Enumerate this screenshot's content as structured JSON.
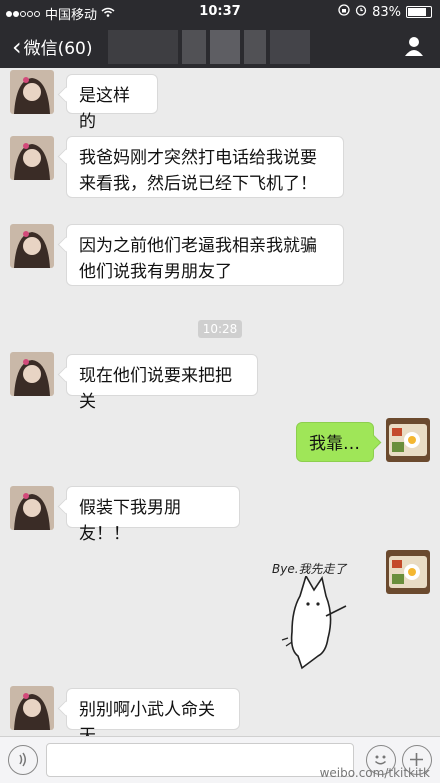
{
  "status": {
    "carrier": "中国移动",
    "time": "10:37",
    "battery": "83%"
  },
  "nav": {
    "back_label": "微信(60)"
  },
  "messages": [
    {
      "text": "是这样的"
    },
    {
      "text": "我爸妈刚才突然打电话给我说要来看我，然后说已经下飞机了！"
    },
    {
      "text": "因为之前他们老逼我相亲我就骗他们说我有男朋友了"
    },
    {
      "timestamp": "10:28"
    },
    {
      "text": "现在他们说要来把把关"
    },
    {
      "text": "我靠…"
    },
    {
      "text": "假装下我男朋友！！"
    },
    {
      "sticker_text": "Bye.我先走了"
    },
    {
      "text": "别别啊小武人命关天"
    }
  ],
  "watermark": "weibo.com/tkitkitk",
  "colors": {
    "outgoing_bubble": "#9fe658",
    "nav_bg": "#2b2b2f"
  }
}
